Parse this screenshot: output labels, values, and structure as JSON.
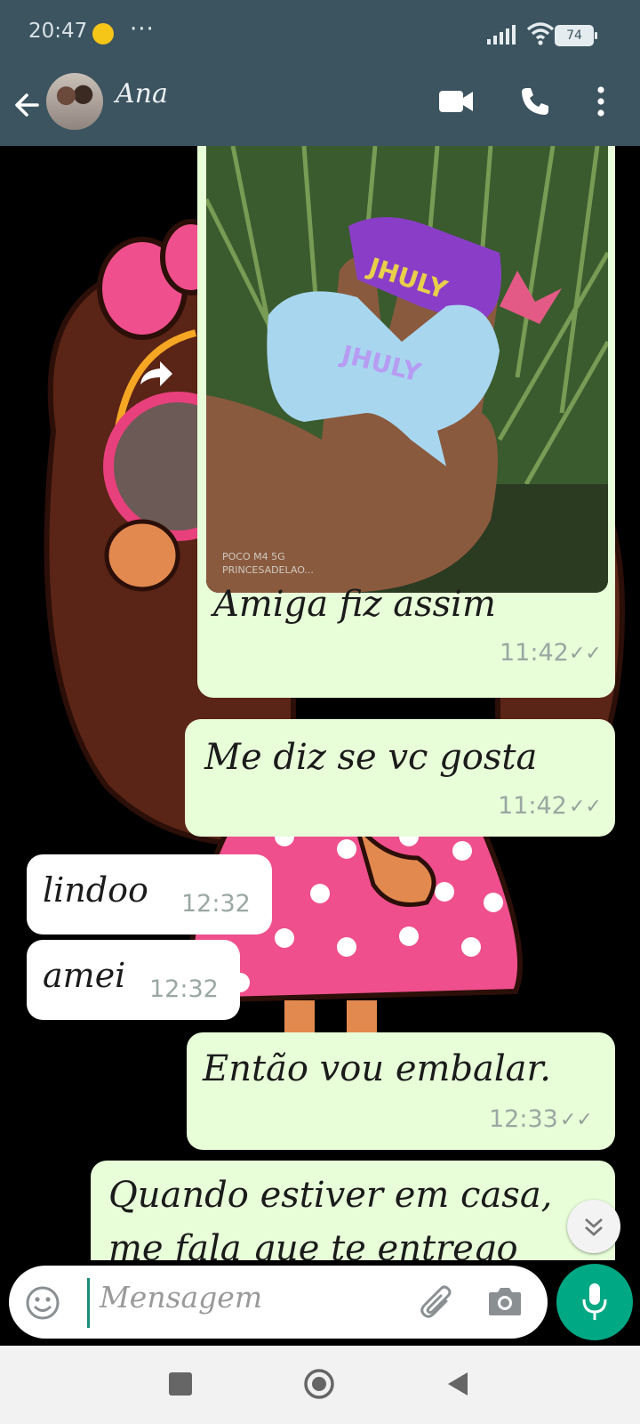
{
  "status_bar": {
    "time": "20:47",
    "more": "···",
    "battery": "74"
  },
  "header": {
    "contact_name": "Ana"
  },
  "messages": [
    {
      "id": "m1",
      "direction": "out",
      "type": "image",
      "caption": "Amiga fiz assim",
      "time": "11:42",
      "image_watermark": "POCO M4 5G\nPRINCESADELAO..."
    },
    {
      "id": "m2",
      "direction": "out",
      "text": "Me diz se vc gosta",
      "time": "11:42"
    },
    {
      "id": "m3",
      "direction": "in",
      "text": "lindoo",
      "time": "12:32"
    },
    {
      "id": "m4",
      "direction": "in",
      "text": "amei",
      "time": "12:32"
    },
    {
      "id": "m5",
      "direction": "out",
      "text": "Então vou embalar.",
      "time": "12:33"
    },
    {
      "id": "m6",
      "direction": "out",
      "text": "Quando estiver em casa,",
      "text_line2": "me fala que te entrego",
      "time": ""
    }
  ],
  "input": {
    "placeholder": "Mensagem"
  },
  "colors": {
    "header_bg": "#3c5460",
    "outgoing_bubble": "#e7fed8",
    "incoming_bubble": "#ffffff",
    "accent": "#00a884"
  },
  "icons": {
    "back": "back-arrow-icon",
    "video": "video-call-icon",
    "call": "phone-icon",
    "menu": "more-vert-icon",
    "emoji": "emoji-icon",
    "attach": "attach-icon",
    "camera": "camera-icon",
    "mic": "mic-icon",
    "scroll": "chevron-double-down-icon",
    "forward": "forward-icon"
  }
}
